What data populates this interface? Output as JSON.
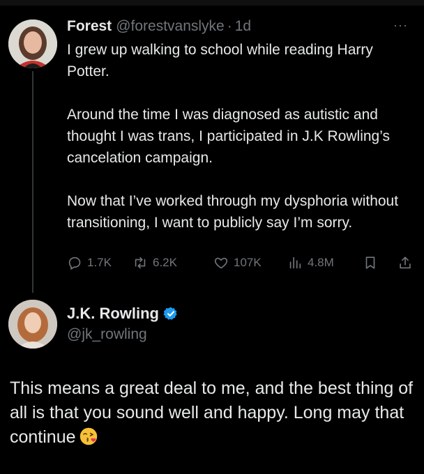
{
  "tweet1": {
    "name": "Forest",
    "handle": "@forestvanslyke",
    "separator": "·",
    "time": "1d",
    "more": "···",
    "paragraphs": [
      "I grew up walking to school while reading Harry Potter.",
      "Around the time I was diagnosed as autistic and thought I was trans, I participated in J.K Rowling’s cancelation campaign.",
      "Now that I’ve worked through my dysphoria without transitioning, I want to publicly say I’m sorry."
    ],
    "stats": {
      "replies": "1.7K",
      "reposts": "6.2K",
      "likes": "107K",
      "views": "4.8M"
    }
  },
  "tweet2": {
    "name": "J.K. Rowling",
    "handle": "@jk_rowling",
    "verified": true,
    "body": "This means a great deal to me, and the best thing of all is that you sound well and happy. Long may that continue",
    "emoji": "face-blowing-a-kiss-icon"
  },
  "colors": {
    "background": "#000000",
    "text": "#e7e9ea",
    "muted": "#71767b",
    "verified": "#1d9bf0"
  }
}
